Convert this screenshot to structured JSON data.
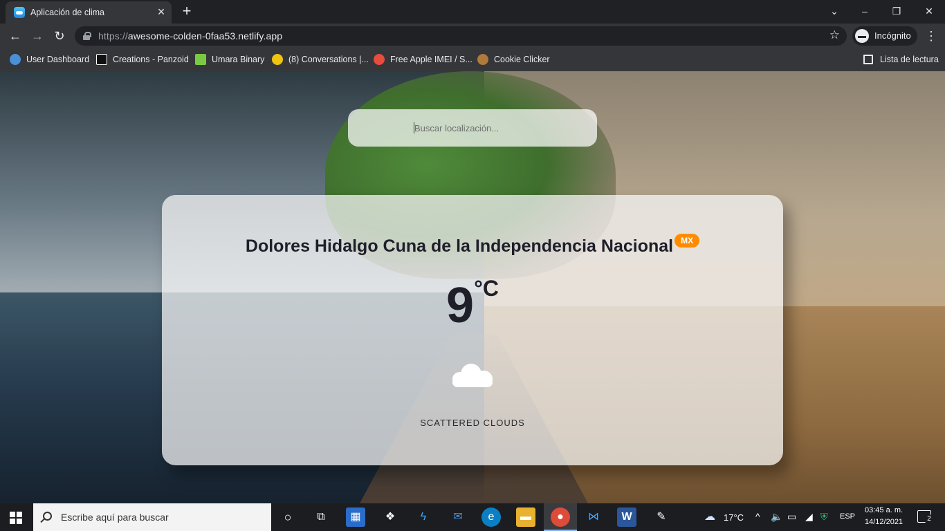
{
  "browser": {
    "tab_title": "Aplicación de clima",
    "url_scheme": "https://",
    "url_host": "awesome-colden-0faa53.netlify.app",
    "incognito_label": "Incógnito",
    "bookmarks": [
      {
        "label": "User Dashboard",
        "icon": "globe-icon",
        "color": "#4a90d9"
      },
      {
        "label": "Creations - Panzoid",
        "icon": "panzoid-icon",
        "color": "#ffffff"
      },
      {
        "label": "Umara Binary",
        "icon": "umara-icon",
        "color": "#7ac943"
      },
      {
        "label": "(8) Conversations |...",
        "icon": "conversations-icon",
        "color": "#f1c40f"
      },
      {
        "label": "Free Apple IMEI / S...",
        "icon": "apple-imei-icon",
        "color": "#e74c3c"
      },
      {
        "label": "Cookie Clicker",
        "icon": "cookie-icon",
        "color": "#b07a3c"
      }
    ],
    "reading_list_label": "Lista de lectura"
  },
  "weather_app": {
    "search": {
      "placeholder": "Buscar localización..."
    },
    "city": "Dolores Hidalgo Cuna de la Independencia Nacional",
    "country": "MX",
    "temperature": "9",
    "unit": "°C",
    "icon": "cloud-icon",
    "description": "SCATTERED CLOUDS",
    "badge_color": "#ff8c00"
  },
  "taskbar": {
    "search_placeholder": "Escribe aquí para buscar",
    "weather_temp": "17°C",
    "language": "ESP",
    "time": "03:45 a. m.",
    "date": "14/12/2021",
    "notification_count": "2"
  }
}
